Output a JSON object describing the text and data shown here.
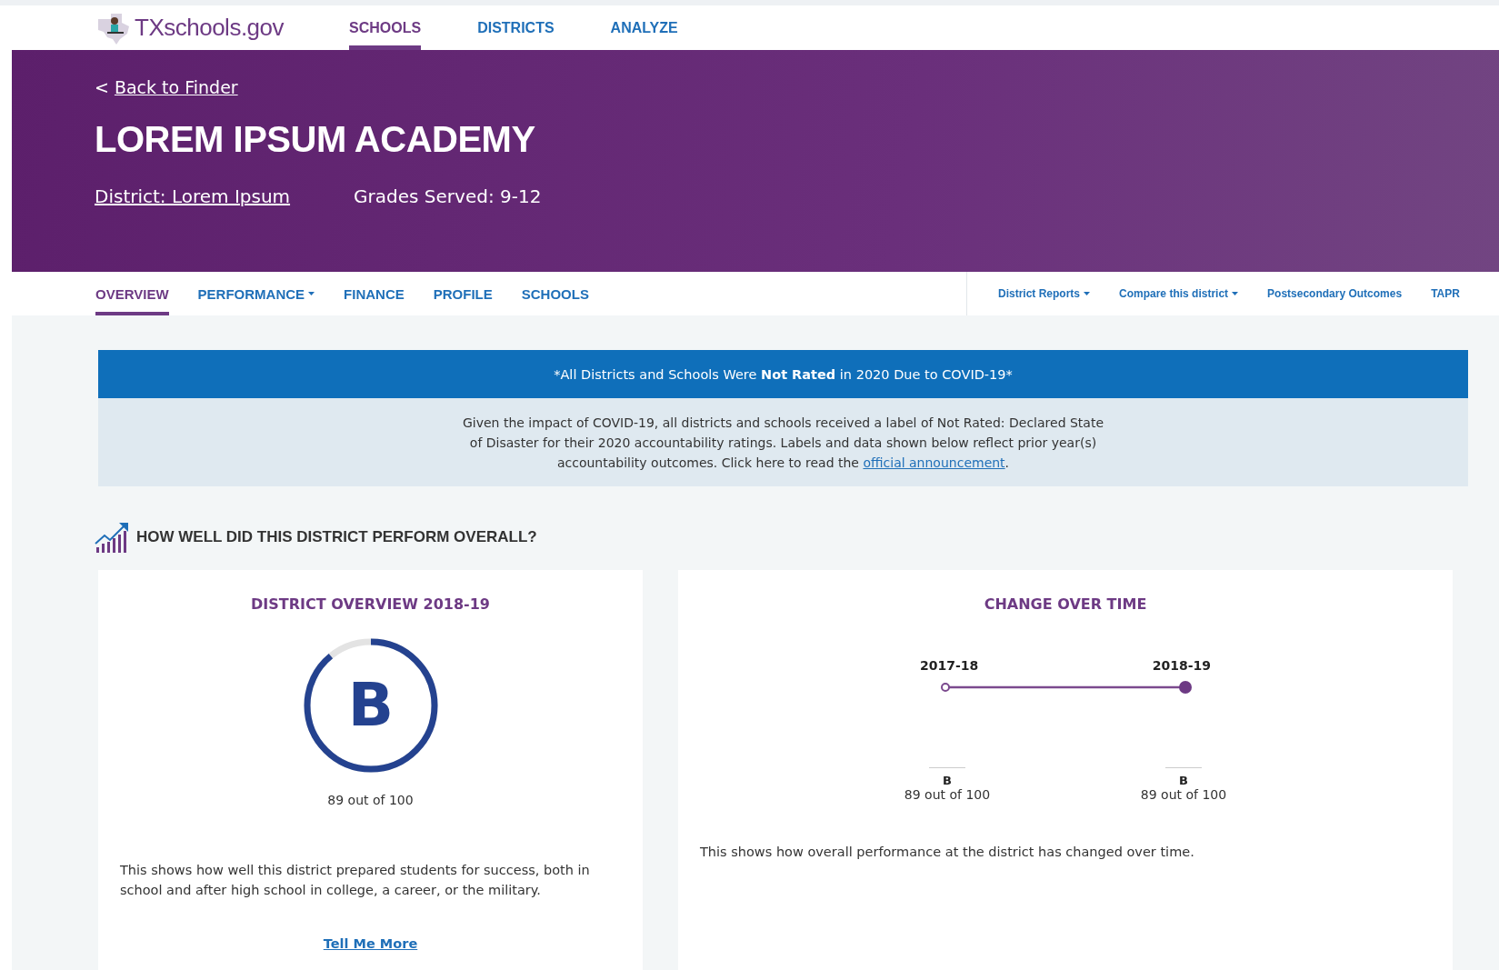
{
  "site": {
    "logo_text": "TXschools.gov"
  },
  "nav": [
    {
      "label": "SCHOOLS",
      "selected": true
    },
    {
      "label": "DISTRICTS",
      "selected": false
    },
    {
      "label": "ANALYZE",
      "selected": false
    }
  ],
  "hero": {
    "back_prefix": "<",
    "back_link": "Back to Finder",
    "title": "LOREM IPSUM ACADEMY",
    "district_link": "District: Lorem Ipsum",
    "grades": "Grades Served: 9-12"
  },
  "tabs": [
    {
      "label": "OVERVIEW",
      "selected": true,
      "dropdown": false
    },
    {
      "label": "PERFORMANCE",
      "selected": false,
      "dropdown": true
    },
    {
      "label": "FINANCE",
      "selected": false,
      "dropdown": false
    },
    {
      "label": "PROFILE",
      "selected": false,
      "dropdown": false
    },
    {
      "label": "SCHOOLS",
      "selected": false,
      "dropdown": false
    }
  ],
  "links": [
    {
      "label": "District Reports",
      "dropdown": true
    },
    {
      "label": "Compare this district",
      "dropdown": true
    },
    {
      "label": "Postsecondary Outcomes",
      "dropdown": false
    },
    {
      "label": "TAPR",
      "dropdown": false
    }
  ],
  "notice": {
    "banner": "*All Districts and Schools Were **Not Rated** in 2020 Due to COVID-19*",
    "body": "Given the impact of COVID-19, all districts and schools received a label of Not Rated: Declared State of Disaster for their 2020 accountability ratings. Labels and data shown below reflect prior year(s) accountability outcomes. Click here to read the",
    "link": "official announcement",
    "after": "."
  },
  "section": {
    "heading": "HOW WELL DID THIS DISTRICT PERFORM OVERALL?"
  },
  "overview_card": {
    "title": "DISTRICT OVERVIEW 2018-19",
    "grade": "B",
    "score": "89 out of 100",
    "description": "This shows how well this district prepared students for success, both in school and after high school in college, a career, or the military.",
    "more_link": "Tell Me More"
  },
  "change_card": {
    "title": "CHANGE OVER TIME",
    "points": [
      {
        "year": "2017-18",
        "grade": "B",
        "score": "89 out of 100",
        "selected": false
      },
      {
        "year": "2018-19",
        "grade": "B",
        "score": "89 out of 100",
        "selected": true
      }
    ],
    "description": "This shows how overall performance at the district has changed over time."
  }
}
